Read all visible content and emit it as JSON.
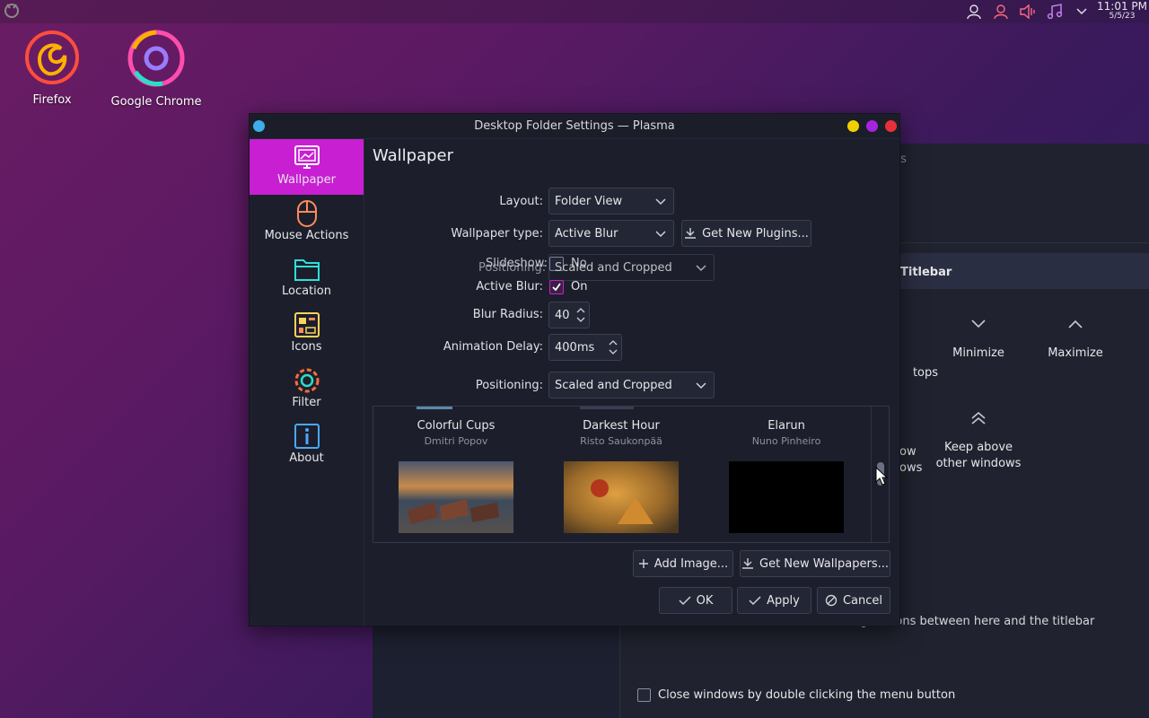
{
  "desktop": {
    "icons": [
      {
        "name": "firefox",
        "label": "Firefox"
      },
      {
        "name": "chrome",
        "label": "Google Chrome"
      }
    ]
  },
  "tray": {
    "time": "11:01 PM",
    "date": "5/5/23"
  },
  "background_window": {
    "partial_header": "ings",
    "titlebar_label": "Titlebar",
    "buttons": [
      {
        "label": "tops"
      },
      {
        "label": "Minimize"
      },
      {
        "label": "Maximize"
      }
    ],
    "row2": {
      "left_label_line1": "ow",
      "left_label_line2": "ows",
      "keep_above": "Keep above other windows"
    },
    "drag_hint": "Drag buttons between here and the titlebar",
    "close_dbl_click": "Close windows by double clicking the menu button"
  },
  "dialog": {
    "title": "Desktop Folder Settings — Plasma",
    "sidebar": [
      {
        "label": "Wallpaper",
        "active": true
      },
      {
        "label": "Mouse Actions"
      },
      {
        "label": "Location"
      },
      {
        "label": "Icons"
      },
      {
        "label": "Filter"
      },
      {
        "label": "About"
      }
    ],
    "page_title": "Wallpaper",
    "form": {
      "layout_label": "Layout:",
      "layout_value": "Folder View",
      "wallpaper_type_label": "Wallpaper type:",
      "wallpaper_type_value": "Active Blur",
      "get_plugins": "Get New Plugins...",
      "slideshow_label": "Slideshow:",
      "slideshow_value": "No",
      "ghost_positioning_label": "Positioning:",
      "ghost_positioning_value": "Scaled and Cropped",
      "active_blur_label": "Active Blur:",
      "active_blur_value": "On",
      "blur_radius_label": "Blur Radius:",
      "blur_radius_value": "40",
      "animation_delay_label": "Animation Delay:",
      "animation_delay_value": "400ms",
      "positioning_label": "Positioning:",
      "positioning_value": "Scaled and Cropped"
    },
    "wallpapers": [
      {
        "name": "Colorful Cups",
        "author": "Dmitri Popov"
      },
      {
        "name": "Darkest Hour",
        "author": "Risto Saukonpää"
      },
      {
        "name": "Elarun",
        "author": "Nuno Pinheiro"
      }
    ],
    "actions": {
      "add_image": "Add Image...",
      "get_wallpapers": "Get New Wallpapers...",
      "ok": "OK",
      "apply": "Apply",
      "cancel": "Cancel"
    }
  },
  "colors": {
    "accent": "#c81fd2",
    "dialog_bg": "#1c1f2b",
    "close_red": "#e8303a",
    "min_yellow": "#f2d000",
    "max_purple": "#a623e0"
  }
}
